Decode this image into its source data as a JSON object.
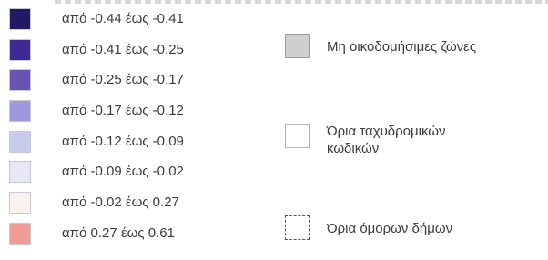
{
  "classes": [
    {
      "label": "από -0.44 έως -0.41",
      "color": "#1f1a63"
    },
    {
      "label": "από -0.41 έως -0.25",
      "color": "#3f2a93"
    },
    {
      "label": "από -0.25 έως -0.17",
      "color": "#6a52b4"
    },
    {
      "label": "από -0.17 έως -0.12",
      "color": "#9c99dc"
    },
    {
      "label": "από -0.12 έως -0.09",
      "color": "#c8cbec"
    },
    {
      "label": "από -0.09 έως -0.02",
      "color": "#e6e7f7"
    },
    {
      "label": "από -0.02 έως 0.27",
      "color": "#f8f1ee"
    },
    {
      "label": "από 0.27 έως 0.61",
      "color": "#f19b96"
    }
  ],
  "extras": {
    "nonbuildable": {
      "label": "Μη οικοδομήσιμες ζώνες",
      "color": "#cfcfcf"
    },
    "postal": {
      "label": "Όρια ταχυδρομικών κωδικών"
    },
    "municipal": {
      "label": "Όρια όμορων δήμων"
    }
  }
}
